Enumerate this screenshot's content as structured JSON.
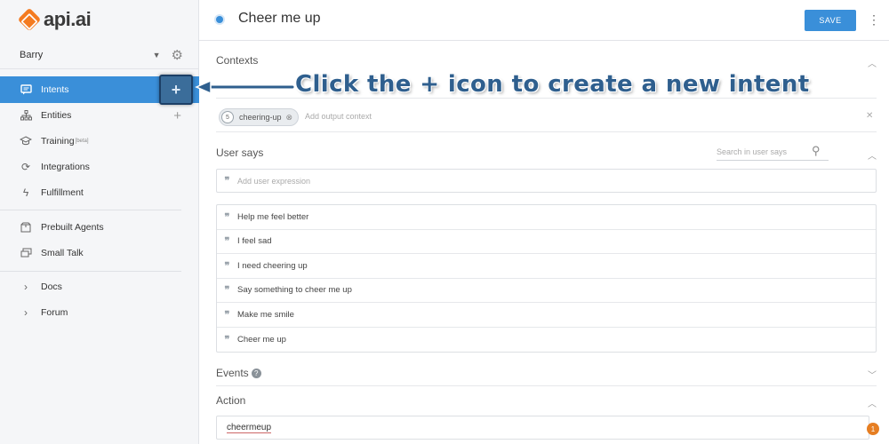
{
  "app": {
    "logo_text": "api.ai"
  },
  "sidebar": {
    "agent_name": "Barry",
    "items": [
      {
        "label": "Intents",
        "icon": "chat-bubble-icon",
        "active": true
      },
      {
        "label": "Entities",
        "icon": "sitemap-icon"
      },
      {
        "label": "Training",
        "badge": "beta",
        "icon": "graduation-cap-icon"
      },
      {
        "label": "Integrations",
        "icon": "refresh-icon"
      },
      {
        "label": "Fulfillment",
        "icon": "lightning-icon"
      },
      {
        "label": "Prebuilt Agents",
        "icon": "box-icon"
      },
      {
        "label": "Small Talk",
        "icon": "chat-boxes-icon"
      },
      {
        "label": "Docs",
        "icon": "chevron-right-icon"
      },
      {
        "label": "Forum",
        "icon": "chevron-right-icon"
      }
    ]
  },
  "header": {
    "title": "Cheer me up",
    "save_label": "SAVE"
  },
  "contexts": {
    "label": "Contexts",
    "output_context": {
      "lifespan": "5",
      "name": "cheering-up"
    },
    "output_placeholder": "Add output context"
  },
  "user_says": {
    "label": "User says",
    "search_placeholder": "Search in user says",
    "input_placeholder": "Add user expression",
    "phrases": [
      "Help me feel better",
      "I feel sad",
      "I need cheering up",
      "Say something to cheer me up",
      "Make me smile",
      "Cheer me up"
    ]
  },
  "events": {
    "label": "Events",
    "help": "?"
  },
  "action": {
    "label": "Action",
    "value": "cheermeup"
  },
  "notification": {
    "count": "1"
  },
  "annotation": {
    "text": "Click the + icon to create a new intent"
  },
  "colors": {
    "accent": "#3a8fd9",
    "brand": "#f47b20",
    "annotation": "#2f5f8e"
  }
}
